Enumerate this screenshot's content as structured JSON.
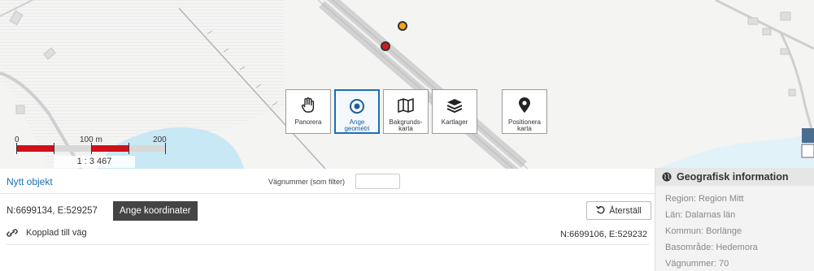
{
  "toolbar": {
    "panorera": "Panorera",
    "ange_geometri": "Ange\ngeometri",
    "bakgrundskarta": "Bakgrunds-\nkarta",
    "kartlager": "Kartlager",
    "positionera_karta": "Positionera\nkarta"
  },
  "scalebar": {
    "zero": "0",
    "mid": "100 m",
    "end": "200 m",
    "ratio": "1 : 3 467"
  },
  "form": {
    "title": "Nytt objekt",
    "filter_label": "Vägnummer (som filter)",
    "filter_value": "",
    "coordinates": "N:6699134, E:529257",
    "enter_coordinates_button": "Ange koordinater",
    "reset_button": "Återställ",
    "linked_to_road": "Kopplad till väg",
    "road_coordinates": "N:6699106, E:529232"
  },
  "geo_panel": {
    "title": "Geografisk information",
    "region": "Region: Region Mitt",
    "lan": "Län: Dalarnas län",
    "kommun": "Kommun: Borlänge",
    "basomrade": "Basområde: Hedemora",
    "vagnummer": "Vägnummer: 70"
  },
  "colors": {
    "accent": "#1a6fb5",
    "marker_selected": "#d6181e",
    "marker_other": "#f2a51d",
    "scale_red": "#d0101a"
  }
}
